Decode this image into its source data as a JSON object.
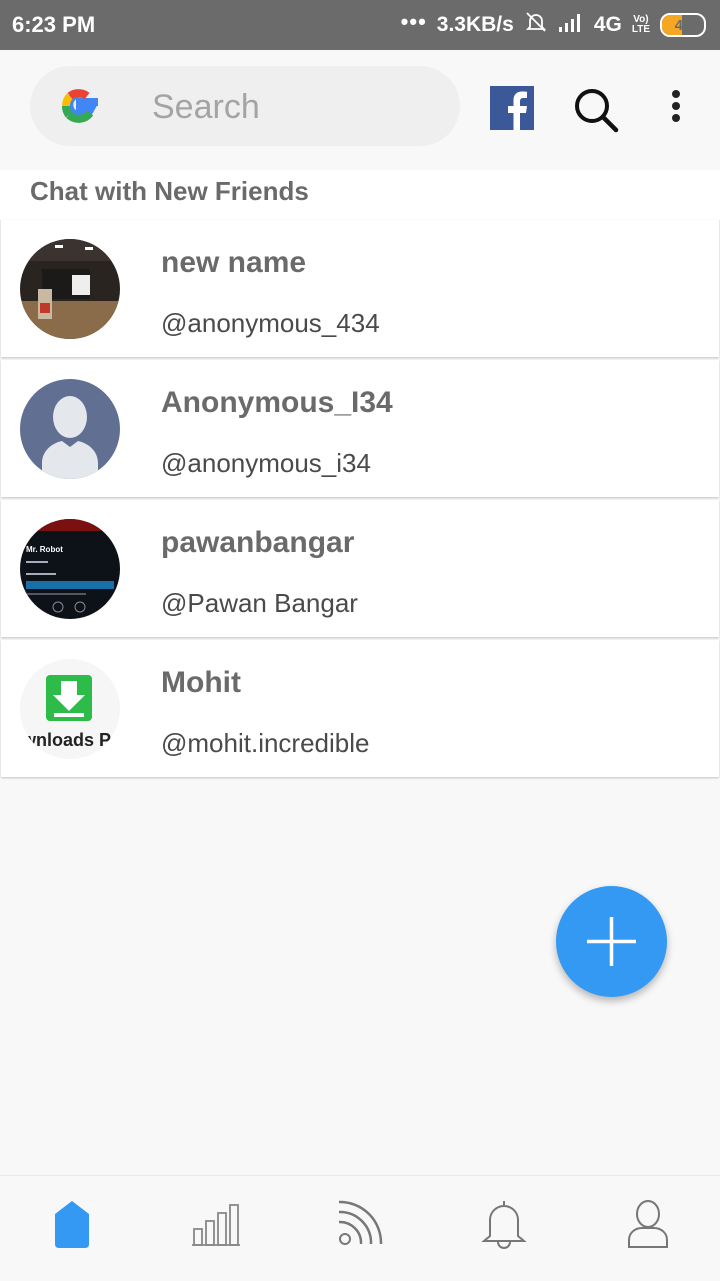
{
  "status_bar": {
    "time": "6:23 PM",
    "dots": "•••",
    "network_speed": "3.3KB/s",
    "network_type": "4G",
    "volte_top": "Vo)",
    "volte_bottom": "LTE",
    "battery_level": "47",
    "icons": [
      "mute-bell-icon",
      "signal-icon"
    ]
  },
  "app_bar": {
    "search_placeholder": "Search",
    "icons": [
      "google-logo",
      "facebook-icon",
      "search-icon",
      "more-vert-icon"
    ],
    "colors": {
      "facebook": "#3b5998",
      "google_blue": "#4285f4",
      "google_red": "#ea4335",
      "google_yellow": "#fbbc05",
      "google_green": "#34a853"
    }
  },
  "section": {
    "title": "Chat with New Friends"
  },
  "friends": [
    {
      "name": "new name",
      "handle": "@anonymous_434",
      "avatar": "conference-photo"
    },
    {
      "name": "Anonymous_I34",
      "handle": "@anonymous_i34",
      "avatar": "default-person"
    },
    {
      "name": "pawanbangar",
      "handle": "@Pawan Bangar",
      "avatar": "mr-robot-screen",
      "avatar_text": "Mr. Robot"
    },
    {
      "name": "Mohit",
      "handle": "@mohit.incredible",
      "avatar": "downloads-icon",
      "avatar_text": "wnloads P"
    }
  ],
  "fab": {
    "icon": "plus-icon",
    "color": "#3399f3"
  },
  "bottom_nav": {
    "items": [
      "home-icon",
      "stats-icon",
      "feed-icon",
      "notifications-icon",
      "profile-icon"
    ],
    "active": "home-icon",
    "active_color": "#3399f3"
  }
}
